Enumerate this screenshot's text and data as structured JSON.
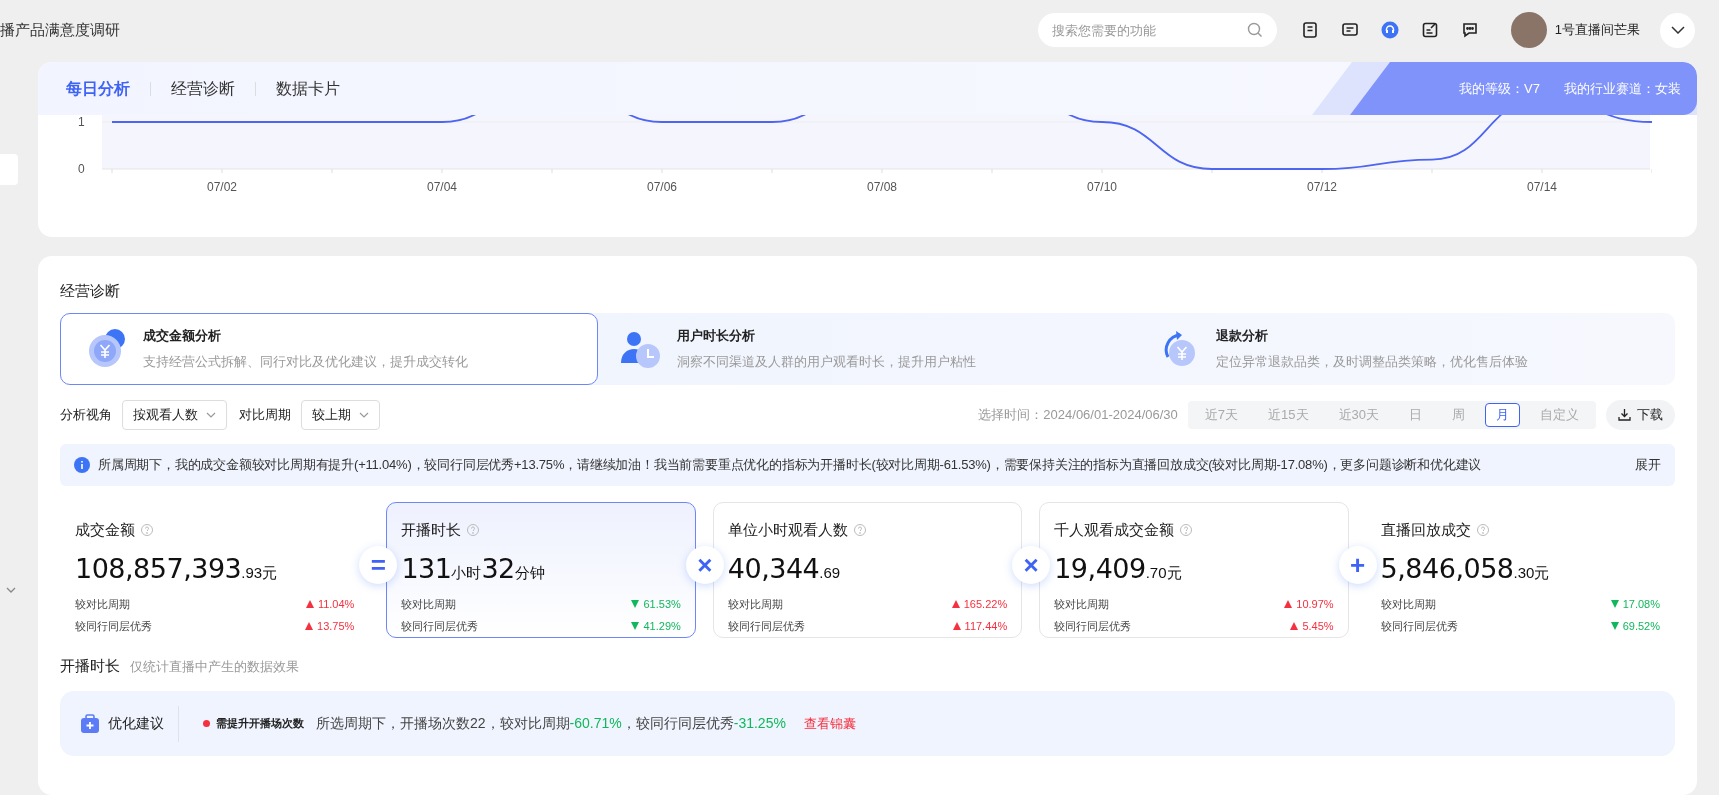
{
  "header": {
    "title": "播产品满意度调研",
    "search": {
      "placeholder": "搜索您需要的功能"
    },
    "user": {
      "name": "1号直播间芒果"
    }
  },
  "daily_card": {
    "tabs": [
      {
        "label": "每日分析",
        "selected": true
      },
      {
        "label": "经营诊断",
        "selected": false
      },
      {
        "label": "数据卡片",
        "selected": false
      }
    ],
    "level": "我的等级：V7",
    "track": "我的行业赛道：女装",
    "chart": {
      "y_ticks": [
        "1",
        "0"
      ],
      "x_labels": [
        "07/02",
        "07/04",
        "07/06",
        "07/08",
        "07/10",
        "07/12",
        "07/14"
      ]
    }
  },
  "diagnosis": {
    "title": "经营诊断",
    "modules": [
      {
        "kind": "money",
        "title": "成交金额分析",
        "desc": "支持经营公式拆解、同行对比及优化建议，提升成交转化",
        "selected": true
      },
      {
        "kind": "time",
        "title": "用户时长分析",
        "desc": "洞察不同渠道及人群的用户观看时长，提升用户粘性",
        "selected": false
      },
      {
        "kind": "refund",
        "title": "退款分析",
        "desc": "定位异常退款品类，及时调整品类策略，优化售后体验",
        "selected": false
      }
    ],
    "filters": [
      {
        "label": "分析视角",
        "value": "按观看人数"
      },
      {
        "label": "对比周期",
        "value": "较上期"
      }
    ],
    "time_label": "选择时间：2024/06/01-2024/06/30",
    "ranges": [
      {
        "label": "近7天",
        "selected": false
      },
      {
        "label": "近15天",
        "selected": false
      },
      {
        "label": "近30天",
        "selected": false
      },
      {
        "label": "日",
        "selected": false
      },
      {
        "label": "周",
        "selected": false
      },
      {
        "label": "月",
        "selected": true
      },
      {
        "label": "自定义",
        "selected": false
      }
    ],
    "download": "下载",
    "notice": {
      "text": "所属周期下，我的成交金额较对比周期有提升(+11.04%)，较同行同层优秀+13.75%，请继续加油！我当前需要重点优化的指标为开播时长(较对比周期-61.53%)，需要保持关注的指标为直播回放成交(较对比周期-17.08%)，更多问题诊断和优化建议",
      "toggle": "展开"
    },
    "metrics": [
      {
        "name": "成交金额",
        "selected": false,
        "value": [
          {
            "text": "108,857,393",
            "kind": "big"
          },
          {
            "text": ".93",
            "kind": "small"
          },
          {
            "text": "元",
            "kind": "small"
          }
        ],
        "stats": [
          {
            "label": "较对比周期",
            "value": "11.04%",
            "up": true
          },
          {
            "label": "较同行同层优秀",
            "value": "13.75%",
            "up": true
          }
        ]
      },
      {
        "name": "开播时长",
        "operator": "=",
        "selected": true,
        "value": [
          {
            "text": "131",
            "kind": "big"
          },
          {
            "text": "小时",
            "kind": "small"
          },
          {
            "text": "32",
            "kind": "big"
          },
          {
            "text": "分钟",
            "kind": "small"
          }
        ],
        "stats": [
          {
            "label": "较对比周期",
            "value": "61.53%",
            "up": false
          },
          {
            "label": "较同行同层优秀",
            "value": "41.29%",
            "up": false
          }
        ]
      },
      {
        "name": "单位小时观看人数",
        "operator": "×",
        "selected": false,
        "value": [
          {
            "text": "40,344",
            "kind": "big"
          },
          {
            "text": ".69",
            "kind": "small"
          }
        ],
        "stats": [
          {
            "label": "较对比周期",
            "value": "165.22%",
            "up": true
          },
          {
            "label": "较同行同层优秀",
            "value": "117.44%",
            "up": true
          }
        ]
      },
      {
        "name": "千人观看成交金额",
        "operator": "×",
        "selected": false,
        "value": [
          {
            "text": "19,409",
            "kind": "big"
          },
          {
            "text": ".70",
            "kind": "small"
          },
          {
            "text": "元",
            "kind": "small"
          }
        ],
        "stats": [
          {
            "label": "较对比周期",
            "value": "10.97%",
            "up": true
          },
          {
            "label": "较同行同层优秀",
            "value": "5.45%",
            "up": true
          }
        ]
      },
      {
        "name": "直播回放成交",
        "operator": "+",
        "selected": false,
        "value": [
          {
            "text": "5,846,058",
            "kind": "big"
          },
          {
            "text": ".30",
            "kind": "small"
          },
          {
            "text": "元",
            "kind": "small"
          }
        ],
        "stats": [
          {
            "label": "较对比周期",
            "value": "17.08%",
            "up": false
          },
          {
            "label": "较同行同层优秀",
            "value": "69.52%",
            "up": false
          }
        ]
      }
    ],
    "section": {
      "title": "开播时长",
      "subtitle": "仅统计直播中产生的数据效果"
    },
    "advice": {
      "label": "优化建议",
      "tag": "需提升开播场次数",
      "segments": [
        {
          "text": "所选周期下，开播场次数22，较对比周期",
          "kind": "plain"
        },
        {
          "text": "-60.71%",
          "kind": "good"
        },
        {
          "text": "，较同行同层优秀",
          "kind": "plain"
        },
        {
          "text": "-31.25%",
          "kind": "good"
        }
      ],
      "link": "查看锦囊"
    }
  }
}
